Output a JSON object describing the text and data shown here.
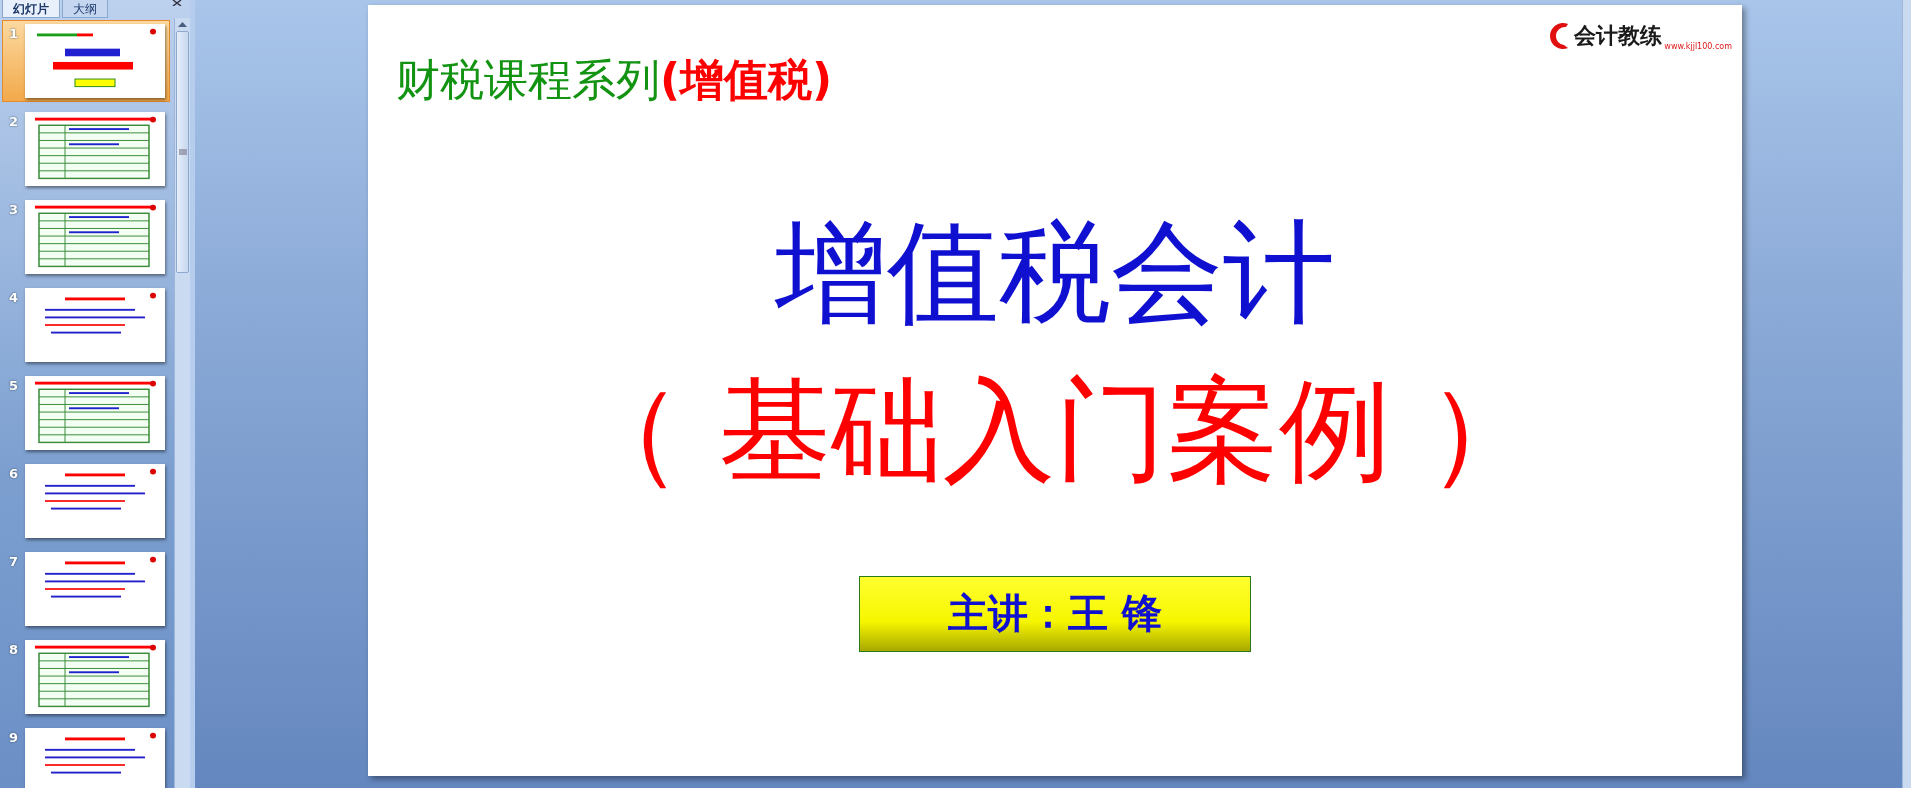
{
  "panel_tabs": [
    {
      "label": "幻灯片",
      "selected": true
    },
    {
      "label": "大纲",
      "selected": false
    }
  ],
  "thumbnails": [
    {
      "number": "1",
      "kind": "title",
      "selected": true
    },
    {
      "number": "2",
      "kind": "table",
      "selected": false
    },
    {
      "number": "3",
      "kind": "table",
      "selected": false
    },
    {
      "number": "4",
      "kind": "text",
      "selected": false
    },
    {
      "number": "5",
      "kind": "table",
      "selected": false
    },
    {
      "number": "6",
      "kind": "text",
      "selected": false
    },
    {
      "number": "7",
      "kind": "text",
      "selected": false
    },
    {
      "number": "8",
      "kind": "table",
      "selected": false
    },
    {
      "number": "9",
      "kind": "text",
      "selected": false
    }
  ],
  "slide": {
    "logo": {
      "name": "会计教练",
      "url": "www.kjjl100.com"
    },
    "series": "财税课程系列",
    "series_topic": "(增值税)",
    "title": "增值税会计",
    "subtitle": "（ 基础入门案例 ）",
    "presenter": "主讲：王 锋"
  }
}
